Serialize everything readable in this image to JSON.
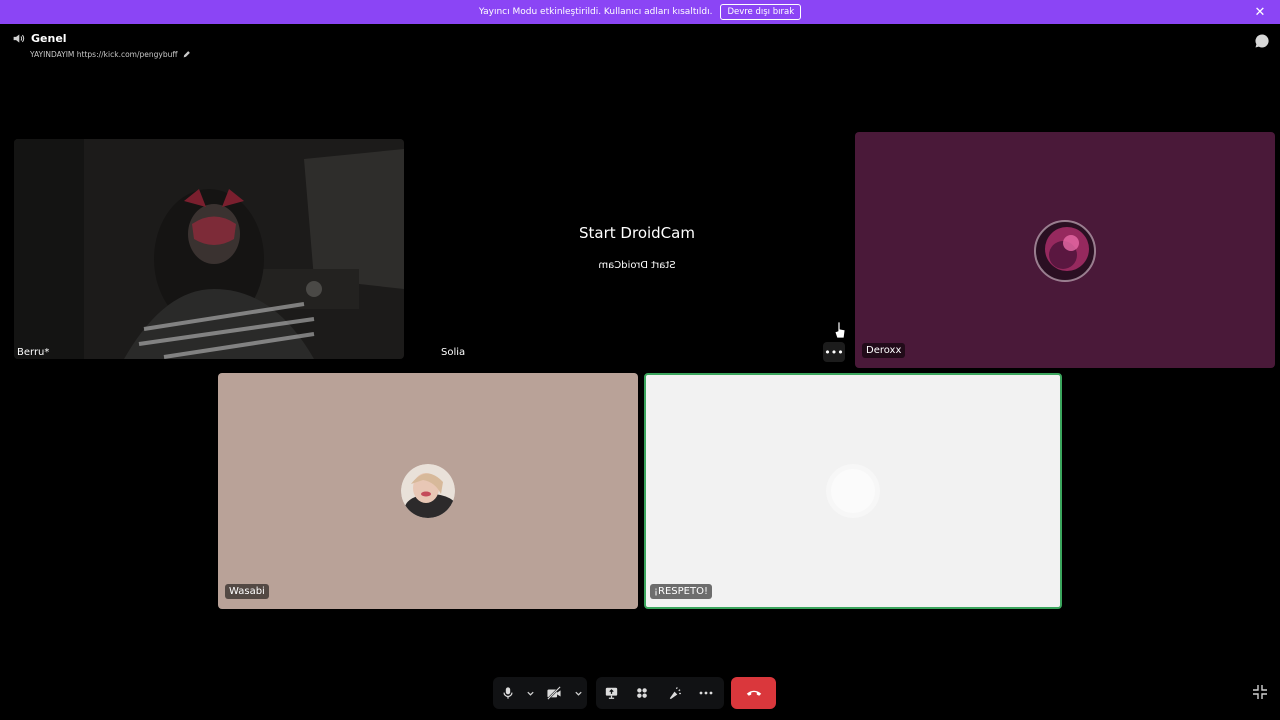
{
  "banner": {
    "message": "Yayıncı Modu etkinleştirildi. Kullanıcı adları kısaltıldı.",
    "disable_button": "Devre dışı bırak",
    "color": "#8b45f5"
  },
  "channel": {
    "name": "Genel",
    "status": "YAYINDAYIM https://kick.com/pengybuff"
  },
  "tiles": {
    "berru": {
      "label": "Berru*"
    },
    "solia": {
      "label": "Solia",
      "title": "Start DroidCam",
      "mirrored_text": "Start DroidCam"
    },
    "deroxx": {
      "label": "Deroxx",
      "bg": "#4a1939"
    },
    "wasabi": {
      "label": "Wasabi",
      "bg": "#b9a298"
    },
    "respeto": {
      "label": "¡RESPETO!",
      "bg": "#f2f2f2",
      "speaking_border": "#3ba55d"
    }
  },
  "controls": {
    "icons": [
      "microphone-icon",
      "camera-off-icon",
      "screen-share-icon",
      "activities-icon",
      "soundboard-icon",
      "more-icon",
      "hang-up-icon",
      "exit-fullscreen-icon"
    ],
    "hangup_color": "#da373c"
  }
}
